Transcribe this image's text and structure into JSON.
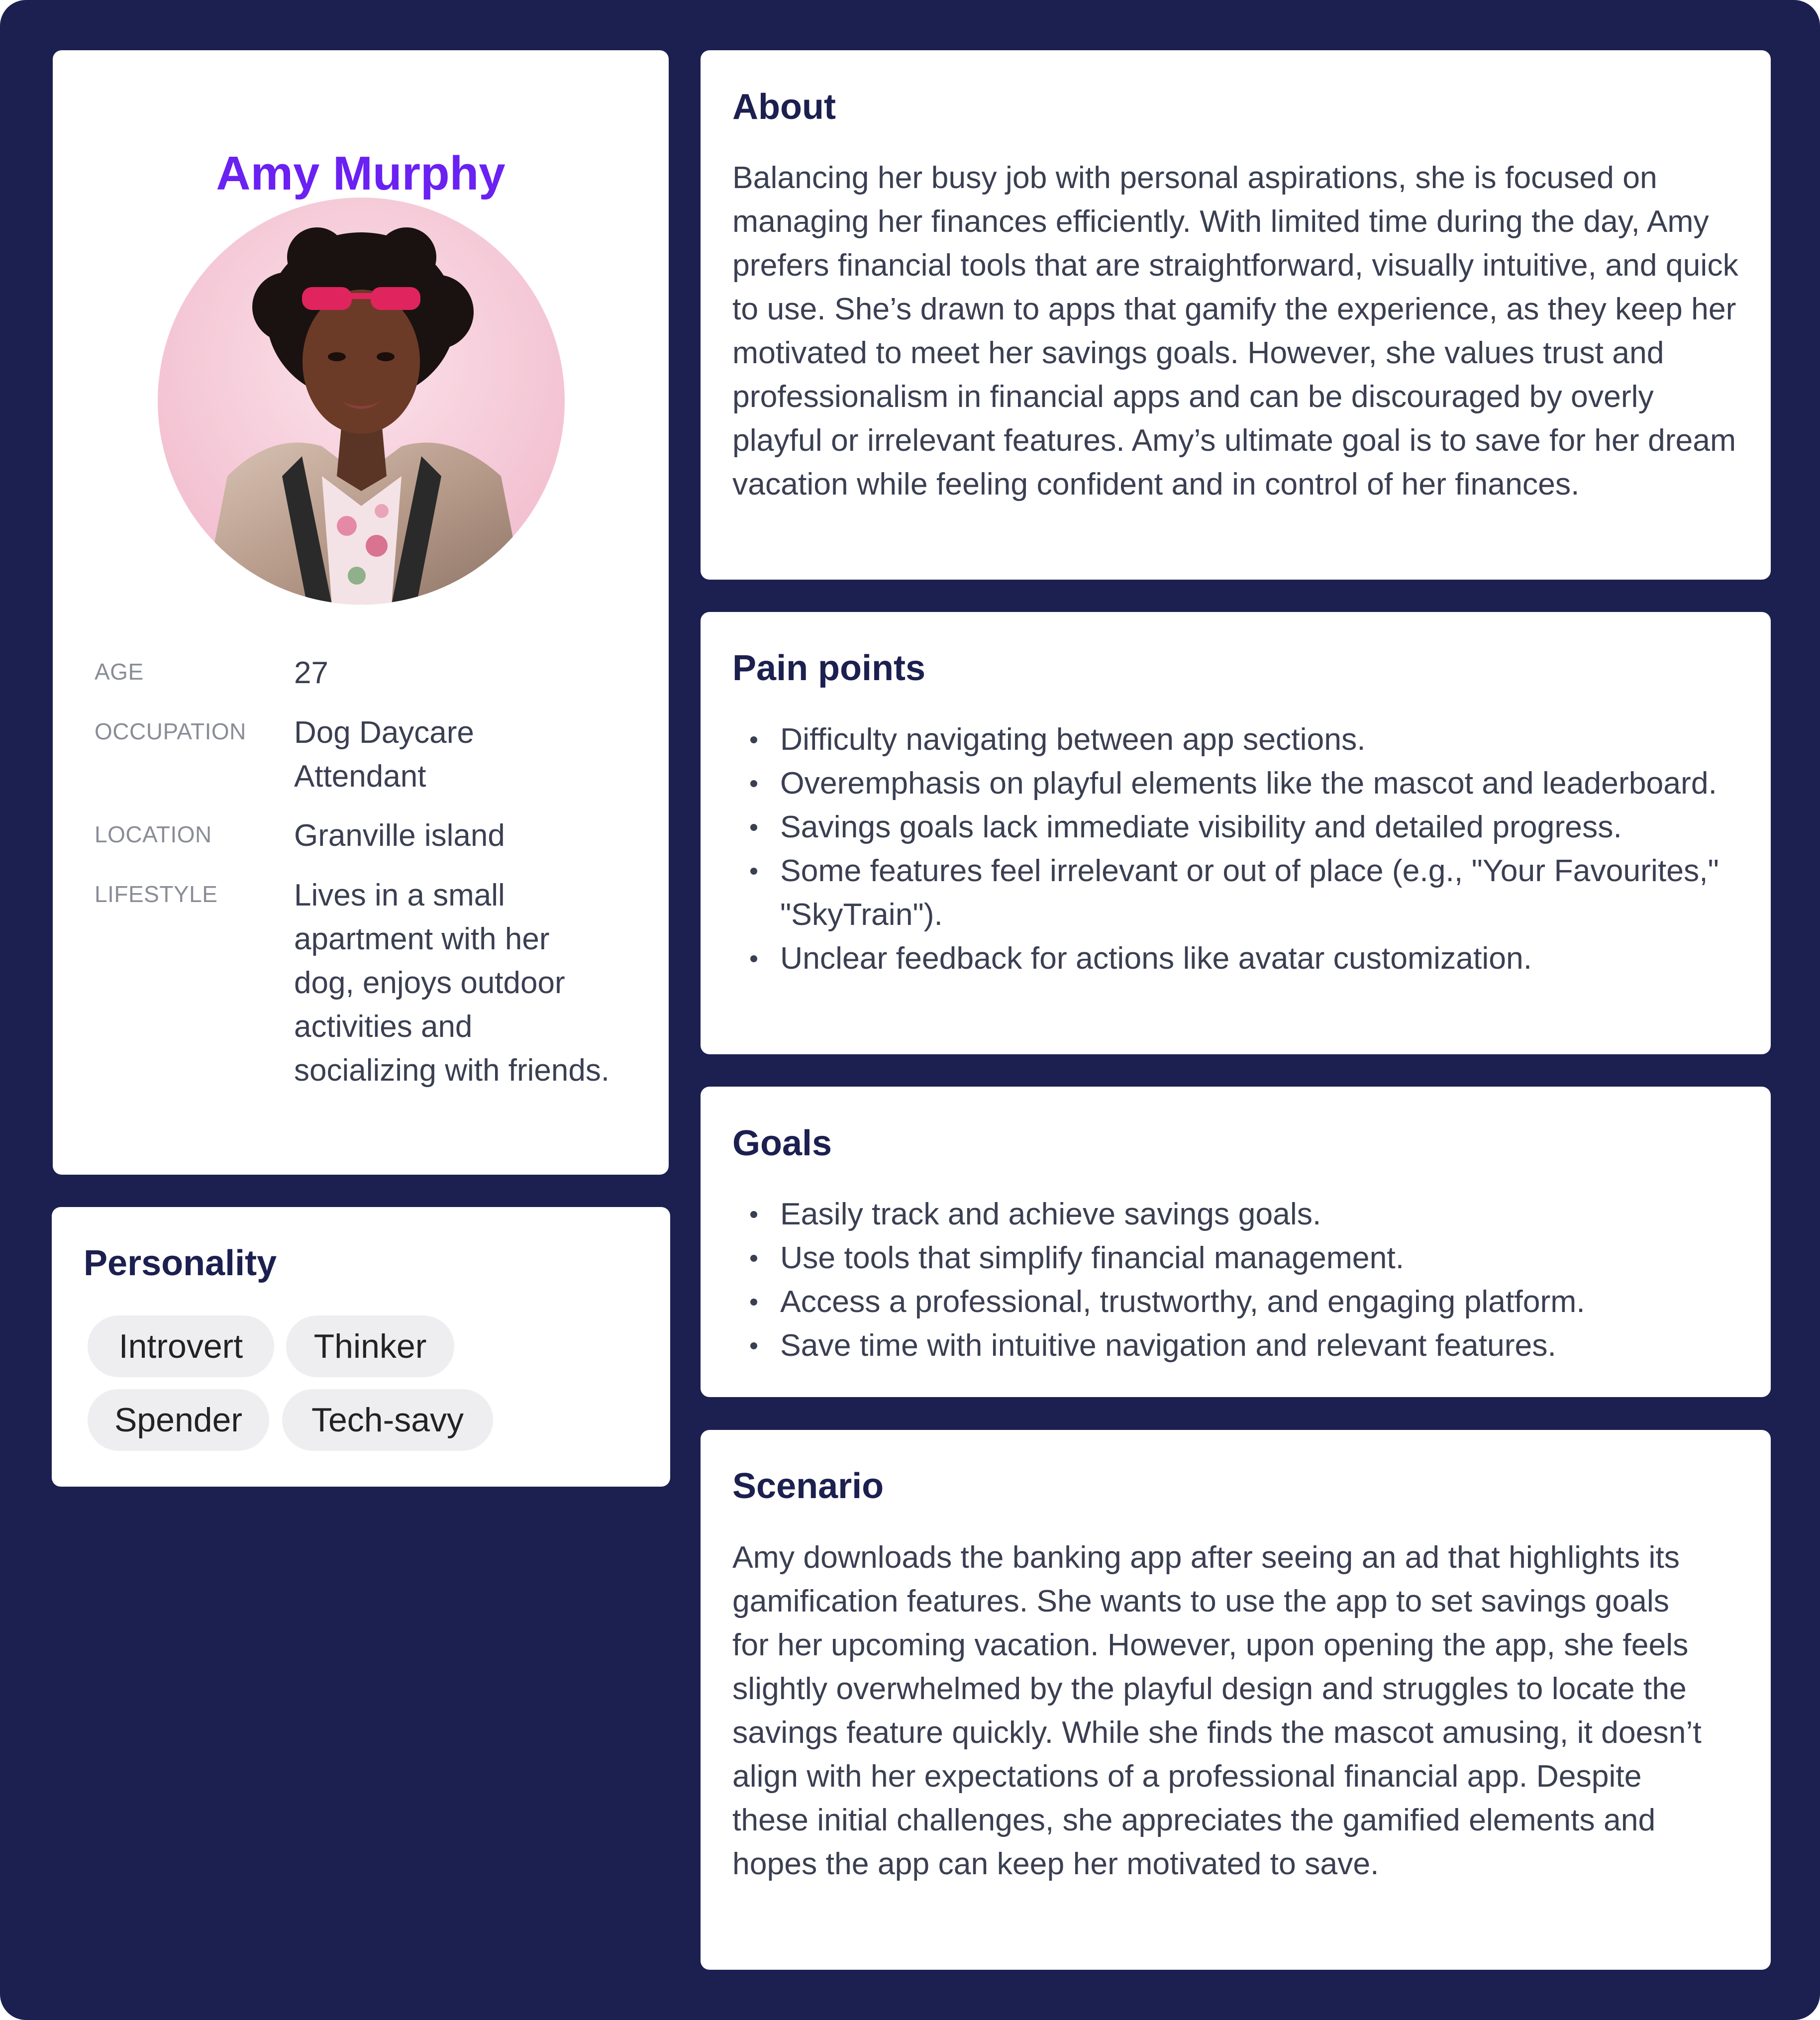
{
  "persona": {
    "name": "Amy Murphy",
    "details": [
      {
        "label": "AGE",
        "value": "27"
      },
      {
        "label": "OCCUPATION",
        "value": "Dog Daycare Attendant"
      },
      {
        "label": "LOCATION",
        "value": "Granville island"
      },
      {
        "label": "LIFESTYLE",
        "value": "Lives in a small apartment with her dog, enjoys outdoor activities and socializing with friends."
      }
    ]
  },
  "personality": {
    "heading": "Personality",
    "tags": [
      "Introvert",
      "Thinker",
      "Spender",
      "Tech-savy"
    ]
  },
  "about": {
    "heading": "About",
    "text": "Balancing her busy job with personal aspirations, she is focused on managing her finances efficiently. With limited time during the day, Amy prefers financial tools that are straightforward, visually intuitive, and quick to use. She’s drawn to apps that gamify the experience, as they keep her motivated to meet her savings goals. However, she values trust and professionalism in financial apps and can be discouraged by overly playful or irrelevant features. Amy’s ultimate goal is to save for her dream vacation while feeling confident and in control of her finances."
  },
  "pain_points": {
    "heading": "Pain points",
    "items": [
      "Difficulty navigating between app sections.",
      "Overemphasis on playful elements like the mascot and leaderboard.",
      "Savings goals lack immediate visibility and detailed progress.",
      "Some features feel irrelevant or out of place (e.g., \"Your Favourites,\" \"SkyTrain\").",
      "Unclear feedback for actions like avatar customization."
    ]
  },
  "goals": {
    "heading": "Goals",
    "items": [
      "Easily track and achieve savings goals.",
      "Use tools that simplify financial management.",
      "Access a professional, trustworthy, and engaging platform.",
      "Save time with intuitive navigation and relevant features."
    ]
  },
  "scenario": {
    "heading": "Scenario",
    "text": "Amy downloads the banking app after seeing an ad that highlights its gamification features. She wants to use the app to set savings goals for her upcoming vacation. However, upon opening the app, she feels slightly overwhelmed by the playful design and struggles to locate the savings feature quickly. While she finds the mascot amusing, it doesn’t align with her expectations of a professional financial app. Despite these initial challenges, she appreciates the gamified elements and hopes the app can keep her motivated to save."
  },
  "colors": {
    "background": "#1c2050",
    "name_accent": "#6a21f2",
    "heading": "#1c2050",
    "tag_bg": "#eeeef0"
  }
}
